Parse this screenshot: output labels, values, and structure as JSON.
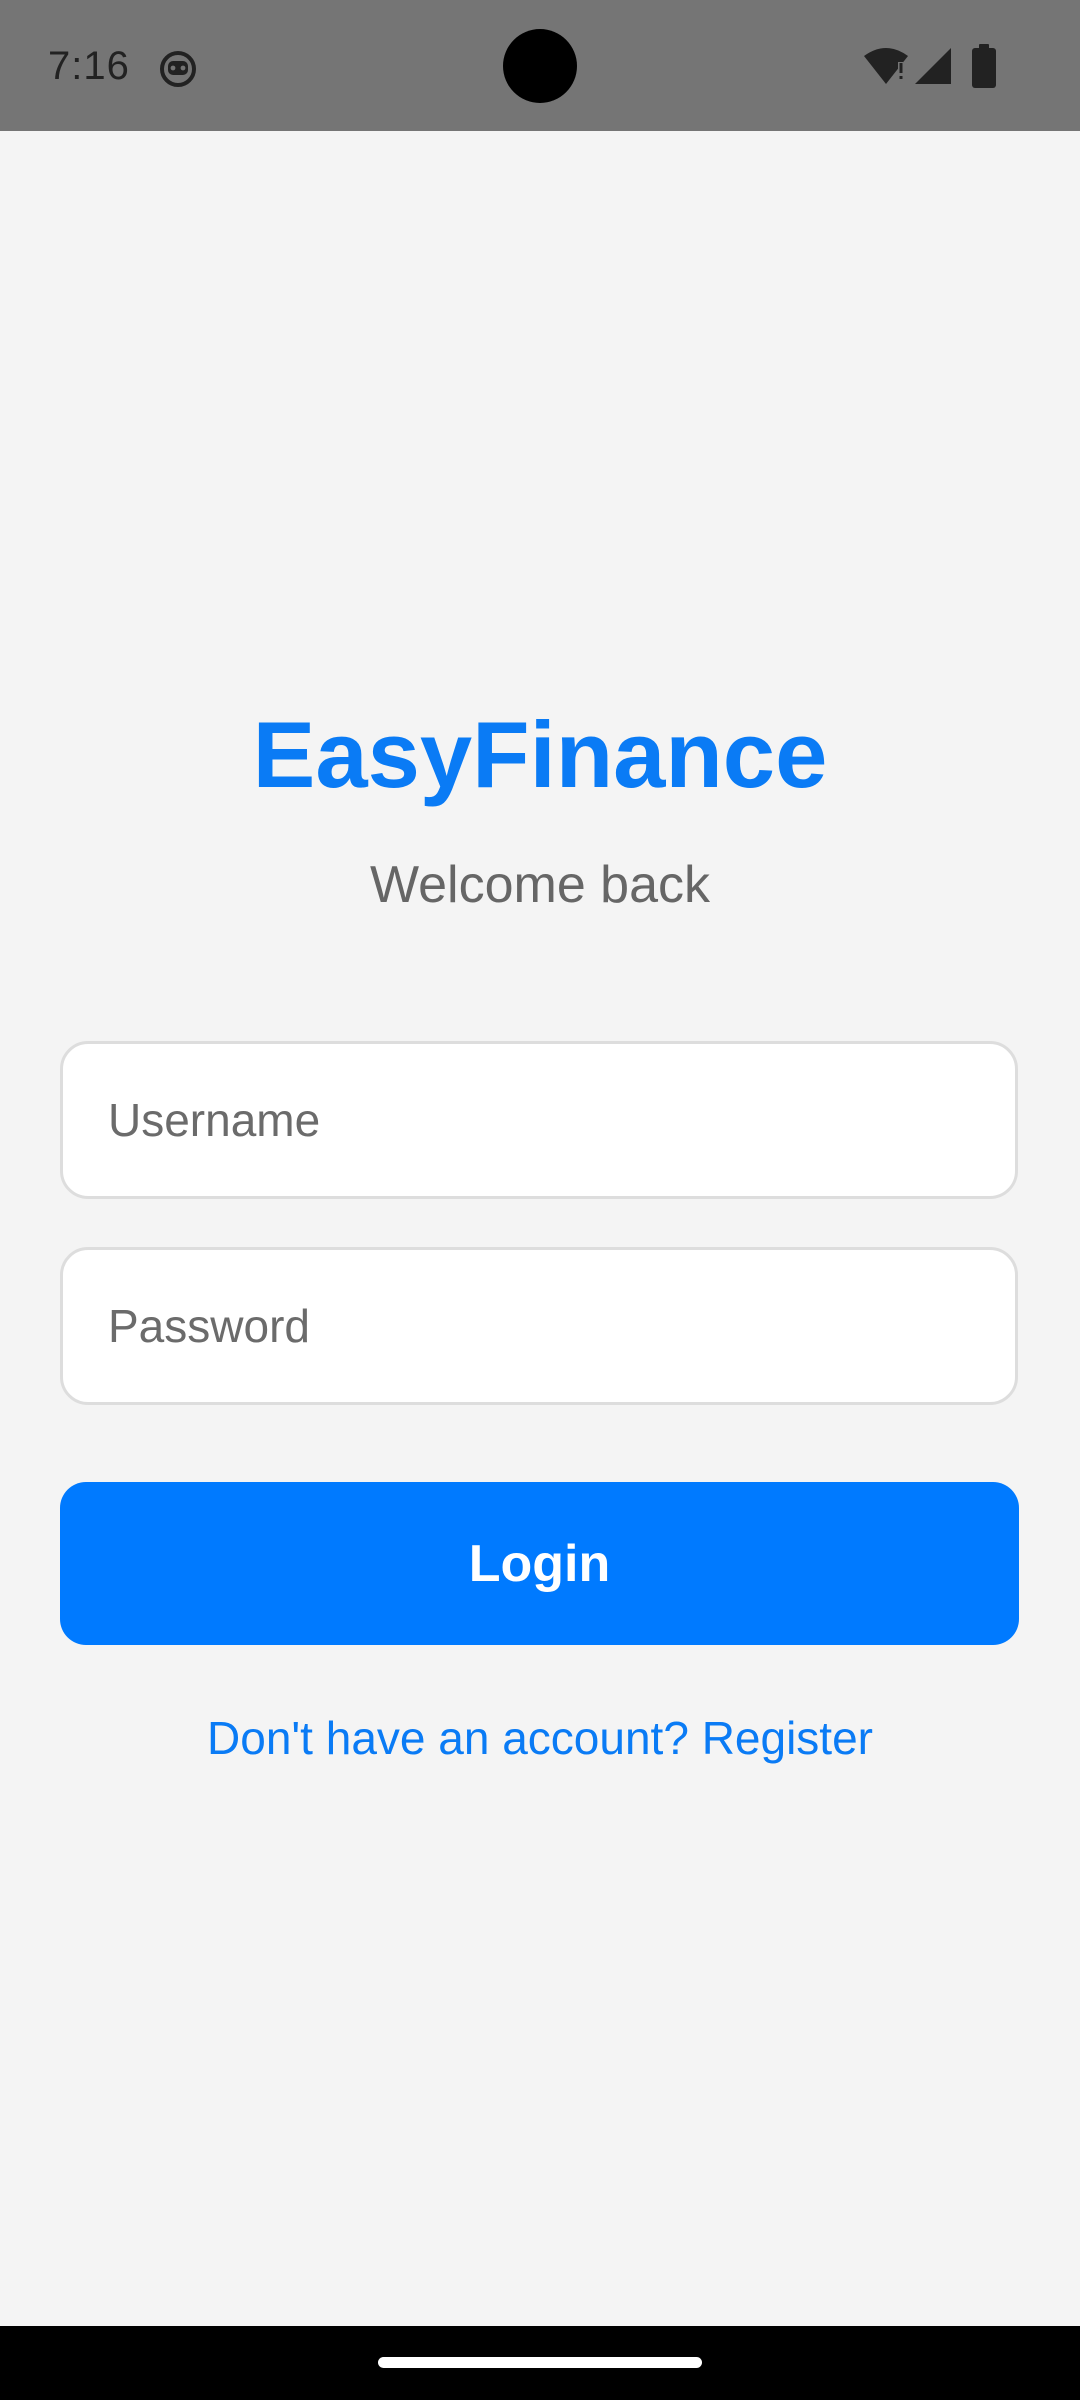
{
  "status_bar": {
    "time": "7:16",
    "icons": [
      "app-notification-icon",
      "wifi-icon",
      "signal-icon",
      "battery-icon"
    ]
  },
  "login": {
    "app_name": "EasyFinance",
    "subtitle": "Welcome back",
    "username_placeholder": "Username",
    "username_value": "",
    "password_placeholder": "Password",
    "password_value": "",
    "login_label": "Login",
    "register_link": "Don't have an account? Register"
  },
  "colors": {
    "accent": "#007aff",
    "title": "#0a7bf5",
    "background": "#f4f4f4",
    "status_bar": "#757575",
    "subtitle": "#666666",
    "field_border": "#dddddd"
  }
}
